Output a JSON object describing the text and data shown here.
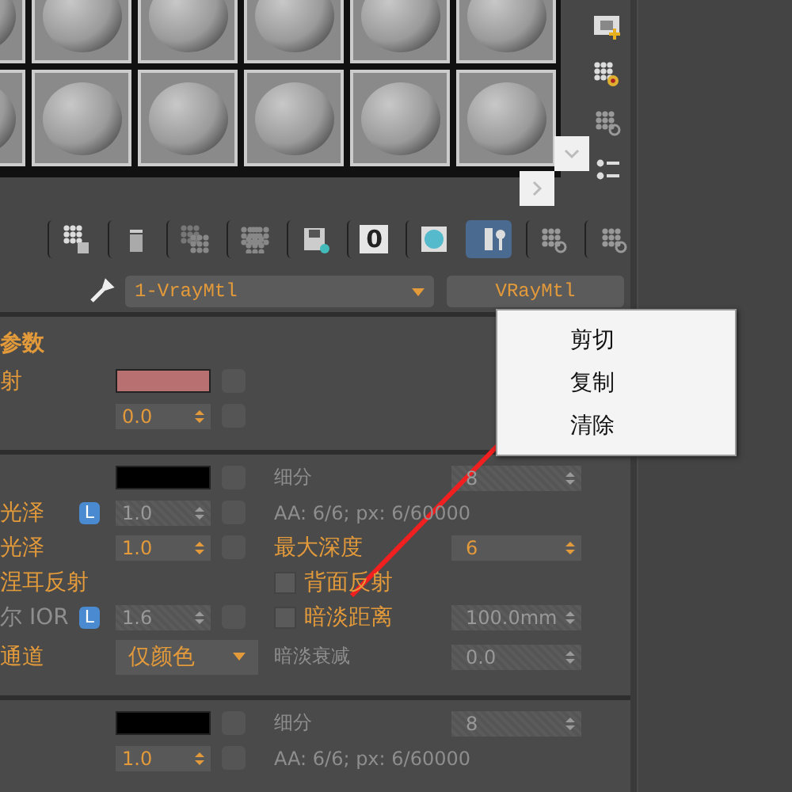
{
  "toolbar": {
    "items": [
      {
        "kind": "hand-box",
        "selected": false
      },
      {
        "kind": "trash",
        "selected": false
      },
      {
        "kind": "spheres",
        "selected": false
      },
      {
        "kind": "spheres-arrows",
        "selected": false
      },
      {
        "kind": "save",
        "selected": false
      },
      {
        "kind": "number",
        "label": "0",
        "selected": false
      },
      {
        "kind": "sphere",
        "selected": false
      },
      {
        "kind": "map-pair",
        "selected": true
      },
      {
        "kind": "magnifier",
        "selected": false
      },
      {
        "kind": "magnifier",
        "selected": false
      }
    ]
  },
  "side_toolbar": {
    "items": [
      {
        "kind": "film-add"
      },
      {
        "kind": "spheres-gear"
      },
      {
        "kind": "magnifier"
      },
      {
        "kind": "list"
      }
    ]
  },
  "material": {
    "name": "1-VrayMtl",
    "type": "VRayMtl"
  },
  "sections": [
    {
      "title": "参数",
      "rows": [
        {
          "label": "射",
          "label_disabled": false,
          "field": {
            "kind": "swatch",
            "color": "#b87070"
          }
        },
        {
          "field": {
            "kind": "spinner",
            "value": "0.0",
            "disabled": false
          }
        }
      ]
    },
    {
      "rows": [
        {
          "field": {
            "kind": "swatch",
            "color": "#000000"
          },
          "right_label": "细分",
          "right_disabled": true,
          "right_field": {
            "value": "8",
            "disabled": true
          }
        },
        {
          "label": "光泽",
          "label_disabled": false,
          "lock": "L",
          "field": {
            "kind": "spinner",
            "value": "1.0",
            "disabled": true
          },
          "right_label": "AA: 6/6; px: 6/60000",
          "right_disabled": true
        },
        {
          "label": "光泽",
          "label_disabled": false,
          "field": {
            "kind": "spinner",
            "value": "1.0",
            "disabled": false
          },
          "right_label": "最大深度",
          "right_disabled": false,
          "right_field": {
            "value": "6",
            "disabled": false
          }
        },
        {
          "label": "涅耳反射",
          "label_disabled": false,
          "right_checkbox": {
            "checked": false
          },
          "right_label": "背面反射",
          "right_disabled": false
        },
        {
          "label": "尔 IOR",
          "label_disabled": true,
          "lock": "L",
          "field": {
            "kind": "spinner",
            "value": "1.6",
            "disabled": true
          },
          "right_checkbox": {
            "checked": false
          },
          "right_label": "暗淡距离",
          "right_disabled": false,
          "right_field": {
            "value": "100.0mm",
            "disabled": true
          }
        },
        {
          "label": "通道",
          "label_disabled": false,
          "field": {
            "kind": "dropdown",
            "value": "仅颜色"
          },
          "right_label": "暗淡衰减",
          "right_disabled": true,
          "right_field": {
            "value": "0.0",
            "disabled": true
          }
        }
      ]
    },
    {
      "rows": [
        {
          "field": {
            "kind": "swatch",
            "color": "#000000"
          },
          "right_label": "细分",
          "right_disabled": true,
          "right_field": {
            "value": "8",
            "disabled": true
          }
        },
        {
          "field": {
            "kind": "spinner",
            "value": "1.0",
            "disabled": false
          },
          "right_label": "AA: 6/6; px: 6/60000",
          "right_disabled": true
        }
      ]
    }
  ],
  "context_menu": {
    "items": [
      "剪切",
      "复制",
      "清除"
    ]
  }
}
